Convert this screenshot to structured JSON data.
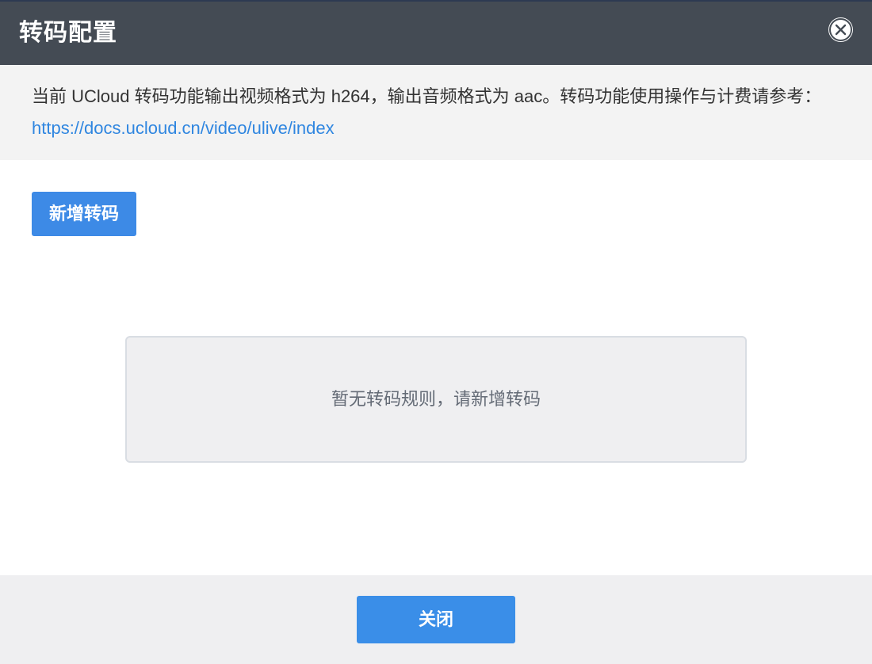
{
  "dialog": {
    "title": "转码配置",
    "close_icon": "close-circle-icon"
  },
  "notice": {
    "text": "当前 UCloud 转码功能输出视频格式为 h264，输出音频格式为 aac。转码功能使用操作与计费请参考：",
    "link_text": "https://docs.ucloud.cn/video/ulive/index"
  },
  "actions": {
    "add_label": "新增转码"
  },
  "empty_state": {
    "message": "暂无转码规则，请新增转码"
  },
  "footer": {
    "close_label": "关闭"
  },
  "colors": {
    "header_bg": "#444b54",
    "primary": "#3d8ae6",
    "link": "#2f86e0"
  }
}
